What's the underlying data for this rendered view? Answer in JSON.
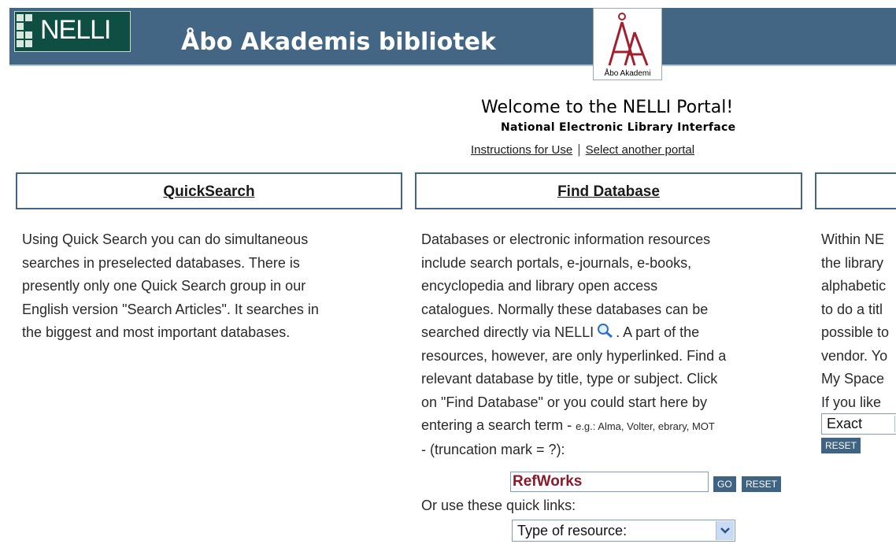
{
  "header": {
    "logo_text": "NELLI",
    "library_name": "Åbo Akademis bibliotek",
    "aa_logo_caption": "Åbo Akademi"
  },
  "welcome": {
    "title": "Welcome to the NELLI Portal!",
    "subtitle": "National Electronic Library Interface",
    "link_instructions": "Instructions for Use",
    "separator": "|",
    "link_portal": "Select another portal"
  },
  "quicksearch": {
    "heading": "QuickSearch",
    "lines": [
      "Using Quick Search you can do simultaneous",
      "searches in preselected databases. There is",
      "presently only one Quick Search group in our",
      "English version \"Search Articles\". It searches in",
      "the biggest and most important databases."
    ]
  },
  "finddb": {
    "heading": "Find Database",
    "lines": [
      "Databases or electronic information resources",
      "include search portals, e-journals, e-books,",
      "encyclopedia and library open access",
      "catalogues. Normally these databases can be"
    ],
    "line5_pre": "searched directly via NELLI",
    "line5_post": ". A part of the",
    "lines_b": [
      "resources, however, are only hyperlinked. Find a",
      "relevant database by title, type or subject. Click",
      "on \"Find Database\" or you could start here by"
    ],
    "line9_pre": "entering a search term - ",
    "line9_small": "e.g.: Alma, Volter, ebrary, MOT",
    "line10": "- (truncation mark = ?):",
    "search_value": "RefWorks",
    "go_label": "GO",
    "reset_label": "RESET",
    "quicklinks_label": "Or use these quick links:",
    "type_select": "Type of resource:"
  },
  "third": {
    "lines": [
      "Within NE",
      "the library",
      "alphabetic",
      "to do a titl",
      "possible to",
      "vendor. Yo",
      "My Space",
      "If you like"
    ],
    "exact_value": "Exact",
    "reset_label": "RESET"
  },
  "colors": {
    "header_bg": "#426683",
    "logo_bg": "#0f4f43",
    "accent_red": "#8b1a2b"
  }
}
